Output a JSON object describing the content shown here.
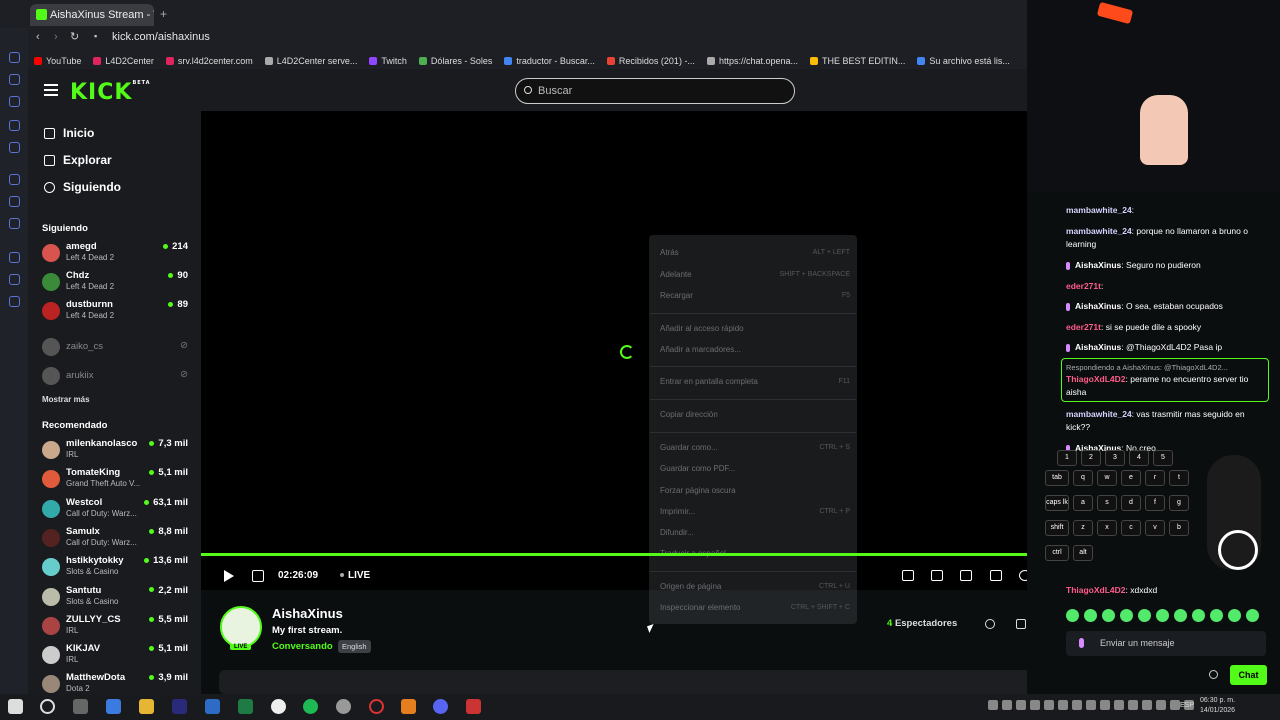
{
  "browser": {
    "tab_title": "AishaXinus Stream - Watch",
    "url": "kick.com/aishaxinus",
    "bookmarks": [
      "YouTube",
      "L4D2Center",
      "srv.l4d2center.com",
      "L4D2Center serve...",
      "Twitch",
      "Dólares - Soles",
      "traductor - Buscar...",
      "Recibidos (201) -...",
      "https://chat.opena...",
      "THE BEST EDITIN...",
      "Su archivo está lis..."
    ]
  },
  "kick": {
    "logo": "KICK",
    "logo_beta": "BETA",
    "search_placeholder": "Buscar",
    "nav": [
      "Inicio",
      "Explorar",
      "Siguiendo"
    ],
    "following_header": "Siguiendo",
    "following": [
      {
        "name": "amegd",
        "game": "Left 4 Dead 2",
        "viewers": "214",
        "live": true,
        "color": "#d9534f"
      },
      {
        "name": "Chdz",
        "game": "Left 4 Dead 2",
        "viewers": "90",
        "live": true,
        "color": "#3a8a3a"
      },
      {
        "name": "dustburnn",
        "game": "Left 4 Dead 2",
        "viewers": "89",
        "live": true,
        "color": "#b22"
      },
      {
        "name": "zaiko_cs",
        "game": "",
        "viewers": "",
        "live": false
      },
      {
        "name": "arukiix",
        "game": "",
        "viewers": "",
        "live": false
      }
    ],
    "show_more": "Mostrar más",
    "recommended_header": "Recomendado",
    "recommended": [
      {
        "name": "milenkanolasco",
        "game": "IRL",
        "viewers": "7,3 mil",
        "color": "#c9a88b"
      },
      {
        "name": "TomateKing",
        "game": "Grand Theft Auto V...",
        "viewers": "5,1 mil",
        "color": "#e05b3b"
      },
      {
        "name": "Westcol",
        "game": "Call of Duty: Warz...",
        "viewers": "63,1 mil",
        "color": "#3aa"
      },
      {
        "name": "Samulx",
        "game": "Call of Duty: Warz...",
        "viewers": "8,8 mil",
        "color": "#522"
      },
      {
        "name": "hstikkytokky",
        "game": "Slots & Casino",
        "viewers": "13,6 mil",
        "color": "#6cc"
      },
      {
        "name": "Santutu",
        "game": "Slots & Casino",
        "viewers": "2,2 mil",
        "color": "#bba"
      },
      {
        "name": "ZULLYY_CS",
        "game": "IRL",
        "viewers": "5,5 mil",
        "color": "#a44"
      },
      {
        "name": "KIKJAV",
        "game": "IRL",
        "viewers": "5,1 mil",
        "color": "#ccc"
      },
      {
        "name": "MatthewDota",
        "game": "Dota 2",
        "viewers": "3,9 mil",
        "color": "#987"
      }
    ]
  },
  "player": {
    "time": "02:26:09",
    "live": "LIVE"
  },
  "context_menu": [
    {
      "label": "Atrás",
      "key": "ALT + LEFT"
    },
    {
      "label": "Adelante",
      "key": "SHIFT + BACKSPACE"
    },
    {
      "label": "Recargar",
      "key": "F5"
    },
    {
      "label": "Añadir al acceso rápido",
      "key": ""
    },
    {
      "label": "Añadir a marcadores...",
      "key": ""
    },
    {
      "label": "Entrar en pantalla completa",
      "key": "F11"
    },
    {
      "label": "Copiar dirección",
      "key": ""
    },
    {
      "label": "Guardar como...",
      "key": "CTRL + S"
    },
    {
      "label": "Guardar como PDF...",
      "key": ""
    },
    {
      "label": "Forzar página oscura",
      "key": ""
    },
    {
      "label": "Imprimir...",
      "key": "CTRL + P"
    },
    {
      "label": "Difundir...",
      "key": ""
    },
    {
      "label": "Traducir a español",
      "key": ""
    },
    {
      "label": "Origen de página",
      "key": "CTRL + U"
    },
    {
      "label": "Inspeccionar elemento",
      "key": "CTRL + SHIFT + C"
    }
  ],
  "stream": {
    "live_badge": "LIVE",
    "name": "AishaXinus",
    "title": "My first stream.",
    "category": "Conversando",
    "language": "English",
    "viewers_count": "4",
    "viewers_label": "Espectadores"
  },
  "chat": {
    "messages": [
      {
        "user": "mambawhite_24",
        "text": "",
        "cls": "u1"
      },
      {
        "user": "mambawhite_24",
        "text": "porque no llamaron a bruno o learning",
        "cls": "u1"
      },
      {
        "user": "AishaXinus",
        "text": "Seguro no pudieron",
        "cls": "u3"
      },
      {
        "user": "eder271t",
        "text": "",
        "cls": "u2"
      },
      {
        "user": "AishaXinus",
        "text": "O sea, estaban ocupados",
        "cls": "u3"
      },
      {
        "user": "eder271t",
        "text": "si se puede dile a spooky",
        "cls": "u2"
      },
      {
        "user": "AishaXinus",
        "text": "@ThiagoXdL4D2 Pasa ip",
        "cls": "u3"
      },
      {
        "user": "ThiagoXdL4D2",
        "text": "perame no encuentro server tio aisha",
        "cls": "u2"
      },
      {
        "user": "mambawhite_24",
        "text": "vas trasmitir mas seguido en kick??",
        "cls": "u1"
      },
      {
        "user": "AishaXinus",
        "text": "No creo",
        "cls": "u3"
      },
      {
        "user": "ThiagoXdL4D2",
        "text": "xdxdxd",
        "cls": "u2"
      }
    ],
    "reply_to": "Respondiendo a AishaXinus: @ThiagoXdL4D2...",
    "input_placeholder": "Enviar un mensaje",
    "send_label": "Chat"
  },
  "keyboard_overlay": {
    "row1": [
      "1",
      "2",
      "3",
      "4",
      "5"
    ],
    "row2": [
      "tab",
      "q",
      "w",
      "e",
      "r",
      "t"
    ],
    "row3": [
      "caps lk",
      "a",
      "s",
      "d",
      "f",
      "g"
    ],
    "row4": [
      "shift",
      "z",
      "x",
      "c",
      "v",
      "b"
    ],
    "row5": [
      "ctrl",
      "alt"
    ]
  },
  "taskbar": {
    "lang": "ESP",
    "time": "06:30 p. m.",
    "date": "14/01/2026"
  }
}
